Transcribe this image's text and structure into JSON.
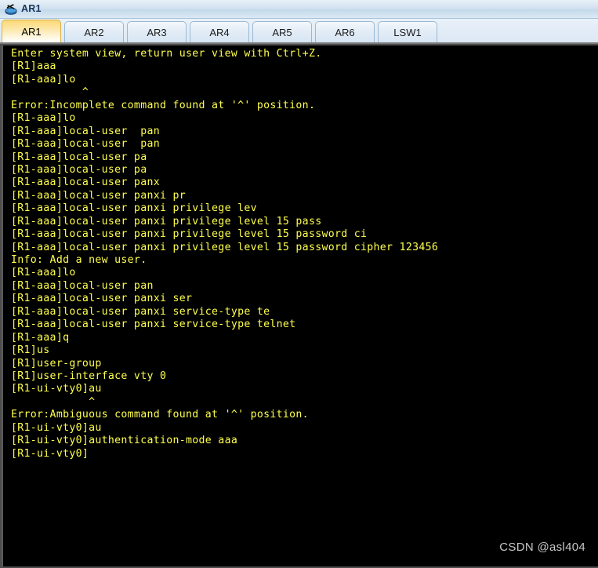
{
  "window": {
    "title": "AR1",
    "icon": "router-icon"
  },
  "tabs": {
    "items": [
      {
        "label": "AR1",
        "active": true
      },
      {
        "label": "AR2",
        "active": false
      },
      {
        "label": "AR3",
        "active": false
      },
      {
        "label": "AR4",
        "active": false
      },
      {
        "label": "AR5",
        "active": false
      },
      {
        "label": "AR6",
        "active": false
      },
      {
        "label": "LSW1",
        "active": false
      }
    ]
  },
  "terminal": {
    "foreground_color": "#ffff4d",
    "background_color": "#000000",
    "lines": [
      "Enter system view, return user view with Ctrl+Z.",
      "[R1]aaa",
      "[R1-aaa]lo",
      "           ^",
      "Error:Incomplete command found at '^' position.",
      "[R1-aaa]lo",
      "[R1-aaa]local-user  pan",
      "[R1-aaa]local-user  pan",
      "[R1-aaa]local-user pa",
      "[R1-aaa]local-user pa",
      "[R1-aaa]local-user panx",
      "[R1-aaa]local-user panxi pr",
      "[R1-aaa]local-user panxi privilege lev",
      "[R1-aaa]local-user panxi privilege level 15 pass",
      "[R1-aaa]local-user panxi privilege level 15 password ci",
      "[R1-aaa]local-user panxi privilege level 15 password cipher 123456",
      "Info: Add a new user.",
      "[R1-aaa]lo",
      "[R1-aaa]local-user pan",
      "[R1-aaa]local-user panxi ser",
      "[R1-aaa]local-user panxi service-type te",
      "[R1-aaa]local-user panxi service-type telnet",
      "[R1-aaa]q",
      "[R1]us",
      "[R1]user-group",
      "[R1]user-interface vty 0",
      "[R1-ui-vty0]au",
      "            ^",
      "Error:Ambiguous command found at '^' position.",
      "[R1-ui-vty0]au",
      "[R1-ui-vty0]authentication-mode aaa",
      "[R1-ui-vty0]"
    ]
  },
  "watermark": {
    "text": "CSDN @asl404"
  }
}
